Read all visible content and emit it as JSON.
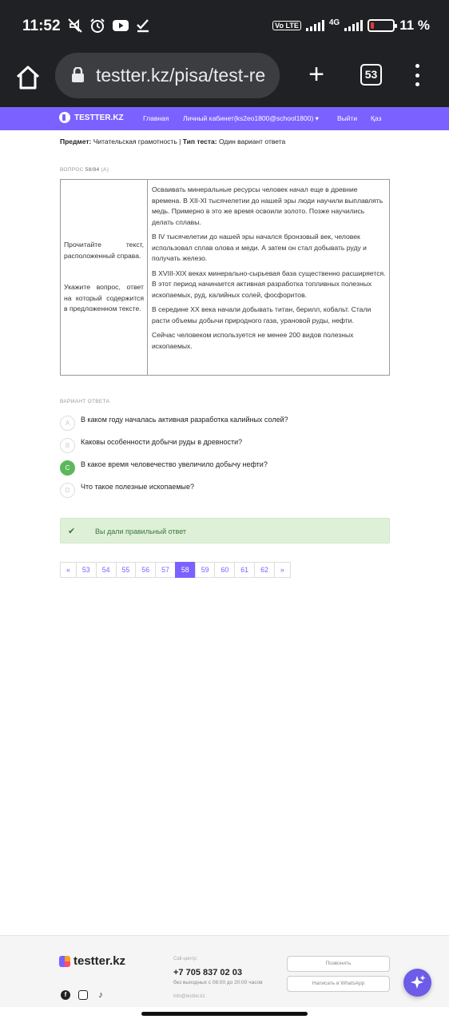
{
  "status_bar": {
    "time": "11:52",
    "network": "4G",
    "volte": "Vo LTE",
    "battery": "11 %",
    "left_icons": [
      "mute-icon",
      "alarm-icon",
      "youtube-icon",
      "check-icon"
    ]
  },
  "browser": {
    "url": "testter.kz/pisa/test-re",
    "tab_count": "53"
  },
  "site_nav": {
    "logo": "TESTTER.KZ",
    "links": [
      "Главная",
      "Личный кабинет(ks2eo1800@school1800) ▾",
      "Выйти",
      "Қаз"
    ]
  },
  "meta": {
    "subject_label": "Предмет:",
    "subject_value": "Читательская грамотность",
    "separator": "|",
    "type_label": "Тип теста:",
    "type_value": "Один вариант ответа"
  },
  "question": {
    "label": "ВОПРОС",
    "number": "58/84",
    "extra": "(A)",
    "instruction_1": "Прочитайте текст, расположенный справа.",
    "instruction_2": "Укажите вопрос, ответ на который содержится в предложенном тексте.",
    "paragraphs": [
      "Осваивать минеральные ресурсы человек начал еще в древние времена. В XII-XI тысячелетии до нашей эры люди научили выплавлять медь. Примерно в это же время освоили золото. Позже научились делать сплавы.",
      "В IV тысячелетии до нашей эры начался бронзовый век, человек использовал сплав олова и меди. А затем он стал добывать руду и получать железо.",
      "В XVIII-XIX веках минерально-сырьевая база существенно расширяется. В этот период начинается активная разработка топливных полезных ископаемых, руд, калийных солей, фосфоритов.",
      "В середине XX века начали добывать титан, берилл, кобальт. Стали расти объемы добычи природного газа, урановой руды, нефти.",
      "Сейчас человеком используется не менее 200 видов полезных ископаемых."
    ]
  },
  "answers": {
    "label": "ВАРИАНТ ОТВЕТА",
    "options": [
      {
        "letter": "A",
        "text": "В каком году началась активная разработка калийных солей?"
      },
      {
        "letter": "B",
        "text": "Каковы особенности добычи руды в древности?"
      },
      {
        "letter": "C",
        "text": "В какое время человечество увеличило добычу нефти?"
      },
      {
        "letter": "D",
        "text": "Что такое полезные ископаемые?"
      }
    ],
    "selected": "C"
  },
  "alert": {
    "message": "Вы дали правильный ответ"
  },
  "pagination": {
    "prev": "«",
    "pages": [
      "53",
      "54",
      "55",
      "56",
      "57",
      "58",
      "59",
      "60",
      "61",
      "62"
    ],
    "active": "58",
    "next": "»"
  },
  "footer": {
    "logo": "testter.kz",
    "callcenter_label": "Call-центр:",
    "phone": "+7 705 837 02 03",
    "hours": "без выходных с 08:00 до 20:00 часов",
    "email": "info@testter.kz",
    "call_button": "Позвонить",
    "whatsapp_button": "Написать в WhatsApp",
    "socials": [
      "facebook-icon",
      "instagram-icon",
      "tiktok-icon"
    ]
  },
  "colors": {
    "brand": "#7b61ff",
    "success_bg": "#dff0d8",
    "success_text": "#3c763d",
    "correct_circle": "#5cb85c",
    "browser_chrome": "#202124"
  }
}
